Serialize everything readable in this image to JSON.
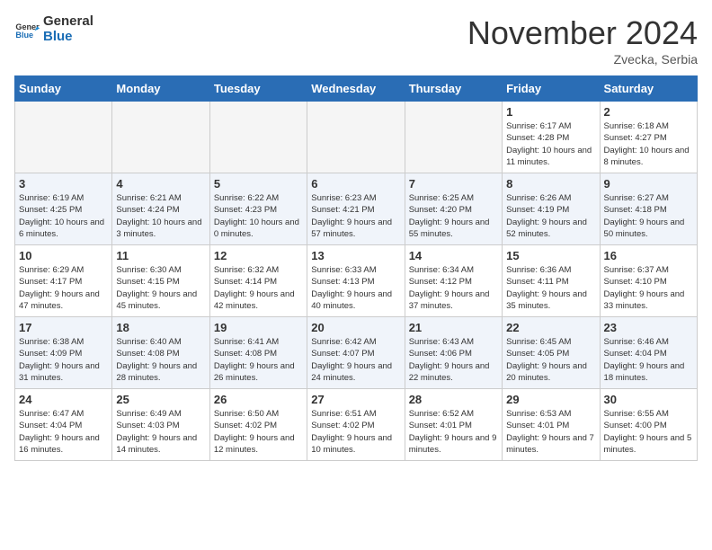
{
  "header": {
    "logo_line1": "General",
    "logo_line2": "Blue",
    "month": "November 2024",
    "location": "Zvecka, Serbia"
  },
  "weekdays": [
    "Sunday",
    "Monday",
    "Tuesday",
    "Wednesday",
    "Thursday",
    "Friday",
    "Saturday"
  ],
  "weeks": [
    [
      {
        "day": "",
        "info": ""
      },
      {
        "day": "",
        "info": ""
      },
      {
        "day": "",
        "info": ""
      },
      {
        "day": "",
        "info": ""
      },
      {
        "day": "",
        "info": ""
      },
      {
        "day": "1",
        "info": "Sunrise: 6:17 AM\nSunset: 4:28 PM\nDaylight: 10 hours and 11 minutes."
      },
      {
        "day": "2",
        "info": "Sunrise: 6:18 AM\nSunset: 4:27 PM\nDaylight: 10 hours and 8 minutes."
      }
    ],
    [
      {
        "day": "3",
        "info": "Sunrise: 6:19 AM\nSunset: 4:25 PM\nDaylight: 10 hours and 6 minutes."
      },
      {
        "day": "4",
        "info": "Sunrise: 6:21 AM\nSunset: 4:24 PM\nDaylight: 10 hours and 3 minutes."
      },
      {
        "day": "5",
        "info": "Sunrise: 6:22 AM\nSunset: 4:23 PM\nDaylight: 10 hours and 0 minutes."
      },
      {
        "day": "6",
        "info": "Sunrise: 6:23 AM\nSunset: 4:21 PM\nDaylight: 9 hours and 57 minutes."
      },
      {
        "day": "7",
        "info": "Sunrise: 6:25 AM\nSunset: 4:20 PM\nDaylight: 9 hours and 55 minutes."
      },
      {
        "day": "8",
        "info": "Sunrise: 6:26 AM\nSunset: 4:19 PM\nDaylight: 9 hours and 52 minutes."
      },
      {
        "day": "9",
        "info": "Sunrise: 6:27 AM\nSunset: 4:18 PM\nDaylight: 9 hours and 50 minutes."
      }
    ],
    [
      {
        "day": "10",
        "info": "Sunrise: 6:29 AM\nSunset: 4:17 PM\nDaylight: 9 hours and 47 minutes."
      },
      {
        "day": "11",
        "info": "Sunrise: 6:30 AM\nSunset: 4:15 PM\nDaylight: 9 hours and 45 minutes."
      },
      {
        "day": "12",
        "info": "Sunrise: 6:32 AM\nSunset: 4:14 PM\nDaylight: 9 hours and 42 minutes."
      },
      {
        "day": "13",
        "info": "Sunrise: 6:33 AM\nSunset: 4:13 PM\nDaylight: 9 hours and 40 minutes."
      },
      {
        "day": "14",
        "info": "Sunrise: 6:34 AM\nSunset: 4:12 PM\nDaylight: 9 hours and 37 minutes."
      },
      {
        "day": "15",
        "info": "Sunrise: 6:36 AM\nSunset: 4:11 PM\nDaylight: 9 hours and 35 minutes."
      },
      {
        "day": "16",
        "info": "Sunrise: 6:37 AM\nSunset: 4:10 PM\nDaylight: 9 hours and 33 minutes."
      }
    ],
    [
      {
        "day": "17",
        "info": "Sunrise: 6:38 AM\nSunset: 4:09 PM\nDaylight: 9 hours and 31 minutes."
      },
      {
        "day": "18",
        "info": "Sunrise: 6:40 AM\nSunset: 4:08 PM\nDaylight: 9 hours and 28 minutes."
      },
      {
        "day": "19",
        "info": "Sunrise: 6:41 AM\nSunset: 4:08 PM\nDaylight: 9 hours and 26 minutes."
      },
      {
        "day": "20",
        "info": "Sunrise: 6:42 AM\nSunset: 4:07 PM\nDaylight: 9 hours and 24 minutes."
      },
      {
        "day": "21",
        "info": "Sunrise: 6:43 AM\nSunset: 4:06 PM\nDaylight: 9 hours and 22 minutes."
      },
      {
        "day": "22",
        "info": "Sunrise: 6:45 AM\nSunset: 4:05 PM\nDaylight: 9 hours and 20 minutes."
      },
      {
        "day": "23",
        "info": "Sunrise: 6:46 AM\nSunset: 4:04 PM\nDaylight: 9 hours and 18 minutes."
      }
    ],
    [
      {
        "day": "24",
        "info": "Sunrise: 6:47 AM\nSunset: 4:04 PM\nDaylight: 9 hours and 16 minutes."
      },
      {
        "day": "25",
        "info": "Sunrise: 6:49 AM\nSunset: 4:03 PM\nDaylight: 9 hours and 14 minutes."
      },
      {
        "day": "26",
        "info": "Sunrise: 6:50 AM\nSunset: 4:02 PM\nDaylight: 9 hours and 12 minutes."
      },
      {
        "day": "27",
        "info": "Sunrise: 6:51 AM\nSunset: 4:02 PM\nDaylight: 9 hours and 10 minutes."
      },
      {
        "day": "28",
        "info": "Sunrise: 6:52 AM\nSunset: 4:01 PM\nDaylight: 9 hours and 9 minutes."
      },
      {
        "day": "29",
        "info": "Sunrise: 6:53 AM\nSunset: 4:01 PM\nDaylight: 9 hours and 7 minutes."
      },
      {
        "day": "30",
        "info": "Sunrise: 6:55 AM\nSunset: 4:00 PM\nDaylight: 9 hours and 5 minutes."
      }
    ]
  ]
}
